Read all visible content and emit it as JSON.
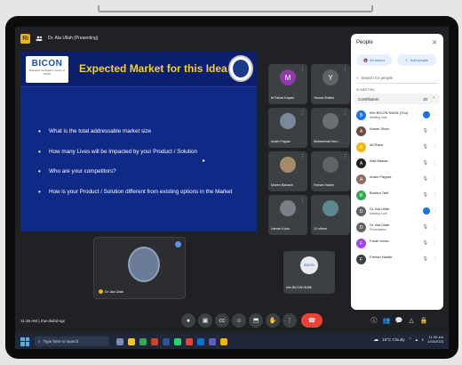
{
  "meet": {
    "presenter_label": "Dr. Ata Ullah (Presenting)",
    "badge": "Ri",
    "meeting_time": "11:35 AM",
    "meeting_code": "mw-dwhd-ajx"
  },
  "slide": {
    "title": "Expected Market for this Idea",
    "logo_text": "BICON",
    "logo_sub": "Business Incubation Center of NUML",
    "bullets": [
      "What is the total addressable market size",
      "How many Lives will be Impacted by your Product / Solution",
      "Who are your competitors?",
      "How is your Product / Solution different from existing options in the Market"
    ]
  },
  "tiles": [
    {
      "name": "M Fahad Kayani",
      "initial": "M",
      "color": "#8e3aa8"
    },
    {
      "name": "Yousra Shaikh",
      "initial": "Y",
      "color": "#5f6368"
    },
    {
      "name": "Anam Fayyaz",
      "initial": "",
      "color": "#7b8a9a"
    },
    {
      "name": "Muhammad Nou...",
      "initial": "",
      "color": "#6d6f73"
    },
    {
      "name": "Moeen Baloach",
      "initial": "",
      "color": "#a38c6c"
    },
    {
      "name": "Farhan Haider",
      "initial": "",
      "color": "#5f6368"
    },
    {
      "name": "Usman Khan",
      "initial": "",
      "color": "#7a7f86"
    },
    {
      "name": "10 others",
      "initial": "",
      "color": "#5a8a8f"
    },
    {
      "name": "Info BICON NUML",
      "initial": "BICON",
      "color": "#e8eaed"
    }
  ],
  "speaker": {
    "name": "Dr. Ata Ullah"
  },
  "people_panel": {
    "title": "People",
    "all_muted": "All muted",
    "add_people": "Add people",
    "search_placeholder": "Search for people",
    "in_meeting": "IN MEETING",
    "contributors_label": "Contributors",
    "contributors_count": "20",
    "list": [
      {
        "name": "Info BICON NUML (You)",
        "status": "Meeting host",
        "color": "#1a73e8",
        "initial": "B",
        "action": "blue"
      },
      {
        "name": "Ahsan Shah",
        "status": "",
        "color": "#6d4c41",
        "initial": "A",
        "action": "mute"
      },
      {
        "name": "Ali Raza",
        "status": "",
        "color": "#f2b705",
        "initial": "A",
        "action": "mute"
      },
      {
        "name": "Atta Nawaz",
        "status": "",
        "color": "#202124",
        "initial": "A",
        "action": "mute"
      },
      {
        "name": "Anam Fayyaz",
        "status": "",
        "color": "#8d6e63",
        "initial": "A",
        "action": "mute"
      },
      {
        "name": "Bushra Tarif",
        "status": "",
        "color": "#34a853",
        "initial": "B",
        "action": "mute"
      },
      {
        "name": "Dr. Ata Ullah",
        "status": "Meeting host",
        "color": "#5f6368",
        "initial": "D",
        "action": "blue"
      },
      {
        "name": "Dr. Ata Ullah",
        "status": "Presentation",
        "color": "#5f6368",
        "initial": "D",
        "action": "mute"
      },
      {
        "name": "Farah Imran",
        "status": "",
        "color": "#a142f4",
        "initial": "F",
        "action": "mute"
      },
      {
        "name": "Farhan Haider",
        "status": "",
        "color": "#3c4043",
        "initial": "F",
        "action": "mute"
      }
    ]
  },
  "taskbar": {
    "search_placeholder": "Type here to search",
    "weather": "19°C Cloudy",
    "time": "11:35 am",
    "date": "1/10/2023"
  }
}
